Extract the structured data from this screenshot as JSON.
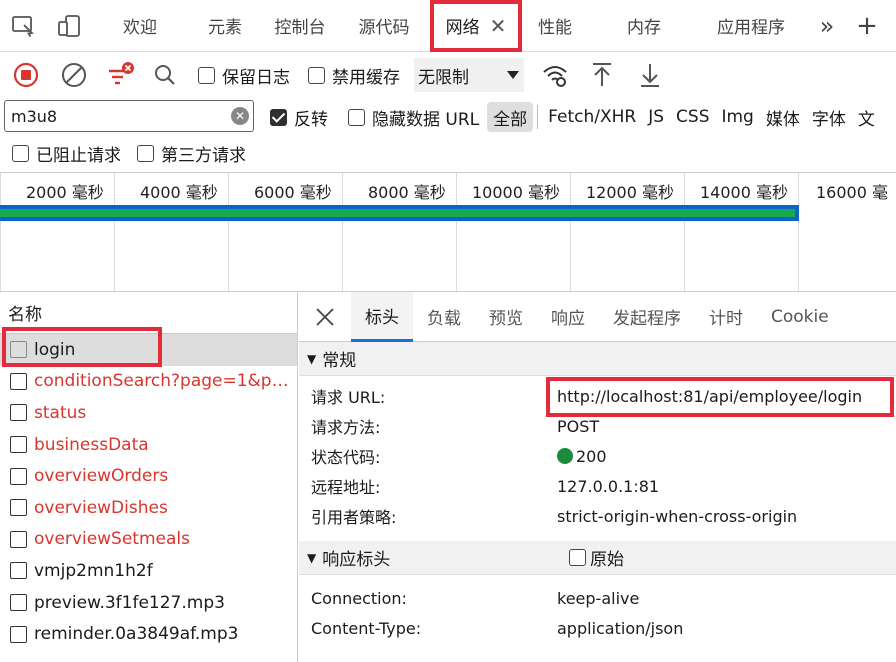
{
  "tabs": [
    {
      "label": "欢迎"
    },
    {
      "label": "元素"
    },
    {
      "label": "控制台"
    },
    {
      "label": "源代码"
    },
    {
      "label": "网络",
      "active": true
    },
    {
      "label": "性能"
    },
    {
      "label": "内存"
    },
    {
      "label": "应用程序"
    }
  ],
  "tab_close": "✕",
  "tab_more": "»",
  "tab_add": "+",
  "toolbar": {
    "preserve_log": "保留日志",
    "disable_cache": "禁用缓存",
    "throttle": "无限制"
  },
  "filter": {
    "value": "m3u8",
    "invert": "反转",
    "hide_data_url": "隐藏数据 URL",
    "types": [
      "全部",
      "Fetch/XHR",
      "JS",
      "CSS",
      "Img",
      "媒体",
      "字体",
      "文"
    ]
  },
  "options": {
    "blocked": "已阻止请求",
    "third_party": "第三方请求"
  },
  "timeline": {
    "ticks": [
      "2000 毫秒",
      "4000 毫秒",
      "6000 毫秒",
      "8000 毫秒",
      "10000 毫秒",
      "12000 毫秒",
      "14000 毫秒",
      "16000 毫"
    ]
  },
  "requests": {
    "header": "名称",
    "items": [
      {
        "name": "login",
        "error": false
      },
      {
        "name": "conditionSearch?page=1&pag...",
        "error": true
      },
      {
        "name": "status",
        "error": true
      },
      {
        "name": "businessData",
        "error": true
      },
      {
        "name": "overviewOrders",
        "error": true
      },
      {
        "name": "overviewDishes",
        "error": true
      },
      {
        "name": "overviewSetmeals",
        "error": true
      },
      {
        "name": "vmjp2mn1h2f",
        "error": false
      },
      {
        "name": "preview.3f1fe127.mp3",
        "error": false
      },
      {
        "name": "reminder.0a3849af.mp3",
        "error": false
      }
    ]
  },
  "details": {
    "tabs": [
      "标头",
      "负载",
      "预览",
      "响应",
      "发起程序",
      "计时",
      "Cookie"
    ],
    "general_title": "常规",
    "general": [
      {
        "key": "请求 URL:",
        "value": "http://localhost:81/api/employee/login"
      },
      {
        "key": "请求方法:",
        "value": "POST"
      },
      {
        "key": "状态代码:",
        "value": "200"
      },
      {
        "key": "远程地址:",
        "value": "127.0.0.1:81"
      },
      {
        "key": "引用者策略:",
        "value": "strict-origin-when-cross-origin"
      }
    ],
    "response_title": "响应标头",
    "raw_label": "原始",
    "response": [
      {
        "key": "Connection:",
        "value": "keep-alive"
      },
      {
        "key": "Content-Type:",
        "value": "application/json"
      }
    ]
  },
  "colors": {
    "highlight": "#e32b3b",
    "status_ok": "#1a8a3c",
    "error_text": "#d9352d"
  }
}
